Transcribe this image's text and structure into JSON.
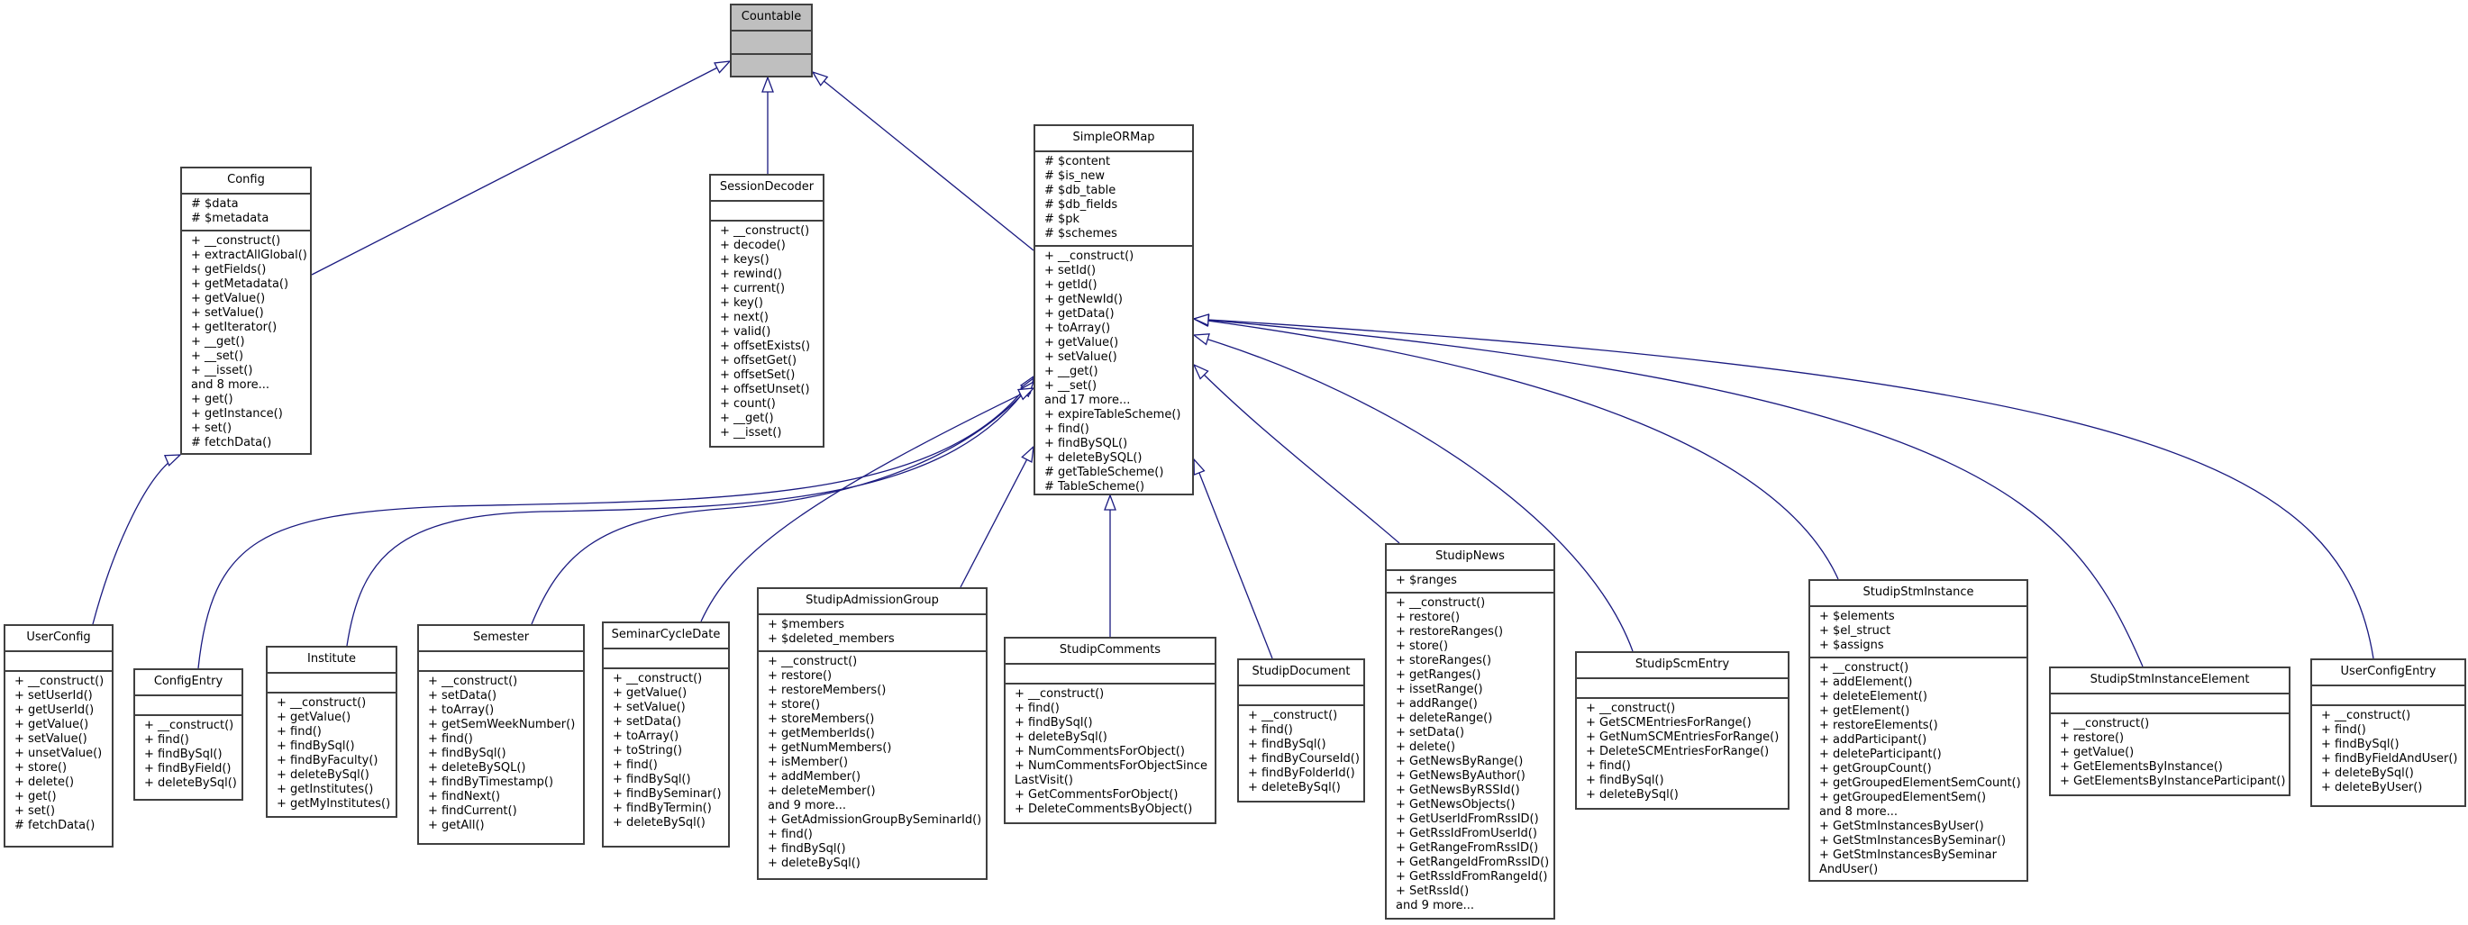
{
  "diagram": {
    "type": "class-inheritance",
    "edge_color": "#1a1a80",
    "root": "Countable",
    "classes": [
      {
        "id": "Countable",
        "name": "Countable",
        "highlight": true,
        "attributes": [],
        "operations": []
      },
      {
        "id": "Config",
        "name": "Config",
        "parent": "Countable",
        "attributes": [
          "# $data",
          "# $metadata"
        ],
        "operations": [
          "+ __construct()",
          "+ extractAllGlobal()",
          "+ getFields()",
          "+ getMetadata()",
          "+ getValue()",
          "+ setValue()",
          "+ getIterator()",
          "+ __get()",
          "+ __set()",
          "+ __isset()",
          "and 8 more...",
          "+ get()",
          "+ getInstance()",
          "+ set()",
          "# fetchData()"
        ]
      },
      {
        "id": "SessionDecoder",
        "name": "SessionDecoder",
        "parent": "Countable",
        "attributes": [],
        "operations": [
          "+ __construct()",
          "+ decode()",
          "+ keys()",
          "+ rewind()",
          "+ current()",
          "+ key()",
          "+ next()",
          "+ valid()",
          "+ offsetExists()",
          "+ offsetGet()",
          "+ offsetSet()",
          "+ offsetUnset()",
          "+ count()",
          "+ __get()",
          "+ __isset()"
        ]
      },
      {
        "id": "SimpleORMap",
        "name": "SimpleORMap",
        "parent": "Countable",
        "attributes": [
          "# $content",
          "# $is_new",
          "# $db_table",
          "# $db_fields",
          "# $pk",
          "# $schemes"
        ],
        "operations": [
          "+ __construct()",
          "+ setId()",
          "+ getId()",
          "+ getNewId()",
          "+ getData()",
          "+ toArray()",
          "+ getValue()",
          "+ setValue()",
          "+ __get()",
          "+ __set()",
          "and 17 more...",
          "+ expireTableScheme()",
          "+ find()",
          "+ findBySQL()",
          "+ deleteBySQL()",
          "# getTableScheme()",
          "# TableScheme()"
        ]
      },
      {
        "id": "UserConfig",
        "name": "UserConfig",
        "parent": "Config",
        "attributes": [],
        "operations": [
          "+ __construct()",
          "+ setUserId()",
          "+ getUserId()",
          "+ getValue()",
          "+ setValue()",
          "+ unsetValue()",
          "+ store()",
          "+ delete()",
          "+ get()",
          "+ set()",
          "# fetchData()"
        ]
      },
      {
        "id": "ConfigEntry",
        "name": "ConfigEntry",
        "parent": "SimpleORMap",
        "attributes": [],
        "operations": [
          "+ __construct()",
          "+ find()",
          "+ findBySql()",
          "+ findByField()",
          "+ deleteBySql()"
        ]
      },
      {
        "id": "Institute",
        "name": "Institute",
        "parent": "SimpleORMap",
        "attributes": [],
        "operations": [
          "+ __construct()",
          "+ getValue()",
          "+ find()",
          "+ findBySql()",
          "+ findByFaculty()",
          "+ deleteBySql()",
          "+ getInstitutes()",
          "+ getMyInstitutes()"
        ]
      },
      {
        "id": "Semester",
        "name": "Semester",
        "parent": "SimpleORMap",
        "attributes": [],
        "operations": [
          "+ __construct()",
          "+ setData()",
          "+ toArray()",
          "+ getSemWeekNumber()",
          "+ find()",
          "+ findBySql()",
          "+ deleteBySQL()",
          "+ findByTimestamp()",
          "+ findNext()",
          "+ findCurrent()",
          "+ getAll()"
        ]
      },
      {
        "id": "SeminarCycleDate",
        "name": "SeminarCycleDate",
        "parent": "SimpleORMap",
        "attributes": [],
        "operations": [
          "+ __construct()",
          "+ getValue()",
          "+ setValue()",
          "+ setData()",
          "+ toArray()",
          "+ toString()",
          "+ find()",
          "+ findBySql()",
          "+ findBySeminar()",
          "+ findByTermin()",
          "+ deleteBySql()"
        ]
      },
      {
        "id": "StudipAdmissionGroup",
        "name": "StudipAdmissionGroup",
        "parent": "SimpleORMap",
        "attributes": [
          "+ $members",
          "+ $deleted_members"
        ],
        "operations": [
          "+ __construct()",
          "+ restore()",
          "+ restoreMembers()",
          "+ store()",
          "+ storeMembers()",
          "+ getMemberIds()",
          "+ getNumMembers()",
          "+ isMember()",
          "+ addMember()",
          "+ deleteMember()",
          "and 9 more...",
          "+ GetAdmissionGroupBySeminarId()",
          "+ find()",
          "+ findBySql()",
          "+ deleteBySql()"
        ]
      },
      {
        "id": "StudipComments",
        "name": "StudipComments",
        "parent": "SimpleORMap",
        "attributes": [],
        "operations": [
          "+ __construct()",
          "+ find()",
          "+ findBySql()",
          "+ deleteBySql()",
          "+ NumCommentsForObject()",
          "+ NumCommentsForObjectSince",
          "LastVisit()",
          "+ GetCommentsForObject()",
          "+ DeleteCommentsByObject()"
        ]
      },
      {
        "id": "StudipDocument",
        "name": "StudipDocument",
        "parent": "SimpleORMap",
        "attributes": [],
        "operations": [
          "+ __construct()",
          "+ find()",
          "+ findBySql()",
          "+ findByCourseId()",
          "+ findByFolderId()",
          "+ deleteBySql()"
        ]
      },
      {
        "id": "StudipNews",
        "name": "StudipNews",
        "parent": "SimpleORMap",
        "attributes": [
          "+ $ranges"
        ],
        "operations": [
          "+ __construct()",
          "+ restore()",
          "+ restoreRanges()",
          "+ store()",
          "+ storeRanges()",
          "+ getRanges()",
          "+ issetRange()",
          "+ addRange()",
          "+ deleteRange()",
          "+ setData()",
          "+ delete()",
          "+ GetNewsByRange()",
          "+ GetNewsByAuthor()",
          "+ GetNewsByRSSId()",
          "+ GetNewsObjects()",
          "+ GetUserIdFromRssID()",
          "+ GetRssIdFromUserId()",
          "+ GetRangeFromRssID()",
          "+ GetRangeIdFromRssID()",
          "+ GetRssIdFromRangeId()",
          "+ SetRssId()",
          "and 9 more..."
        ]
      },
      {
        "id": "StudipScmEntry",
        "name": "StudipScmEntry",
        "parent": "SimpleORMap",
        "attributes": [],
        "operations": [
          "+ __construct()",
          "+ GetSCMEntriesForRange()",
          "+ GetNumSCMEntriesForRange()",
          "+ DeleteSCMEntriesForRange()",
          "+ find()",
          "+ findBySql()",
          "+ deleteBySql()"
        ]
      },
      {
        "id": "StudipStmInstance",
        "name": "StudipStmInstance",
        "parent": "SimpleORMap",
        "attributes": [
          "+ $elements",
          "+ $el_struct",
          "+ $assigns"
        ],
        "operations": [
          "+ __construct()",
          "+ addElement()",
          "+ deleteElement()",
          "+ getElement()",
          "+ restoreElements()",
          "+ addParticipant()",
          "+ deleteParticipant()",
          "+ getGroupCount()",
          "+ getGroupedElementSemCount()",
          "+ getGroupedElementSem()",
          "and 8 more...",
          "+ GetStmInstancesByUser()",
          "+ GetStmInstancesBySeminar()",
          "+ GetStmInstancesBySeminar",
          "AndUser()"
        ]
      },
      {
        "id": "StudipStmInstanceElement",
        "name": "StudipStmInstanceElement",
        "parent": "SimpleORMap",
        "attributes": [],
        "operations": [
          "+ __construct()",
          "+ restore()",
          "+ getValue()",
          "+ GetElementsByInstance()",
          "+ GetElementsByInstanceParticipant()"
        ]
      },
      {
        "id": "UserConfigEntry",
        "name": "UserConfigEntry",
        "parent": "SimpleORMap",
        "attributes": [],
        "operations": [
          "+ __construct()",
          "+ find()",
          "+ findBySql()",
          "+ findByFieldAndUser()",
          "+ deleteBySql()",
          "+ deleteByUser()"
        ]
      }
    ]
  }
}
